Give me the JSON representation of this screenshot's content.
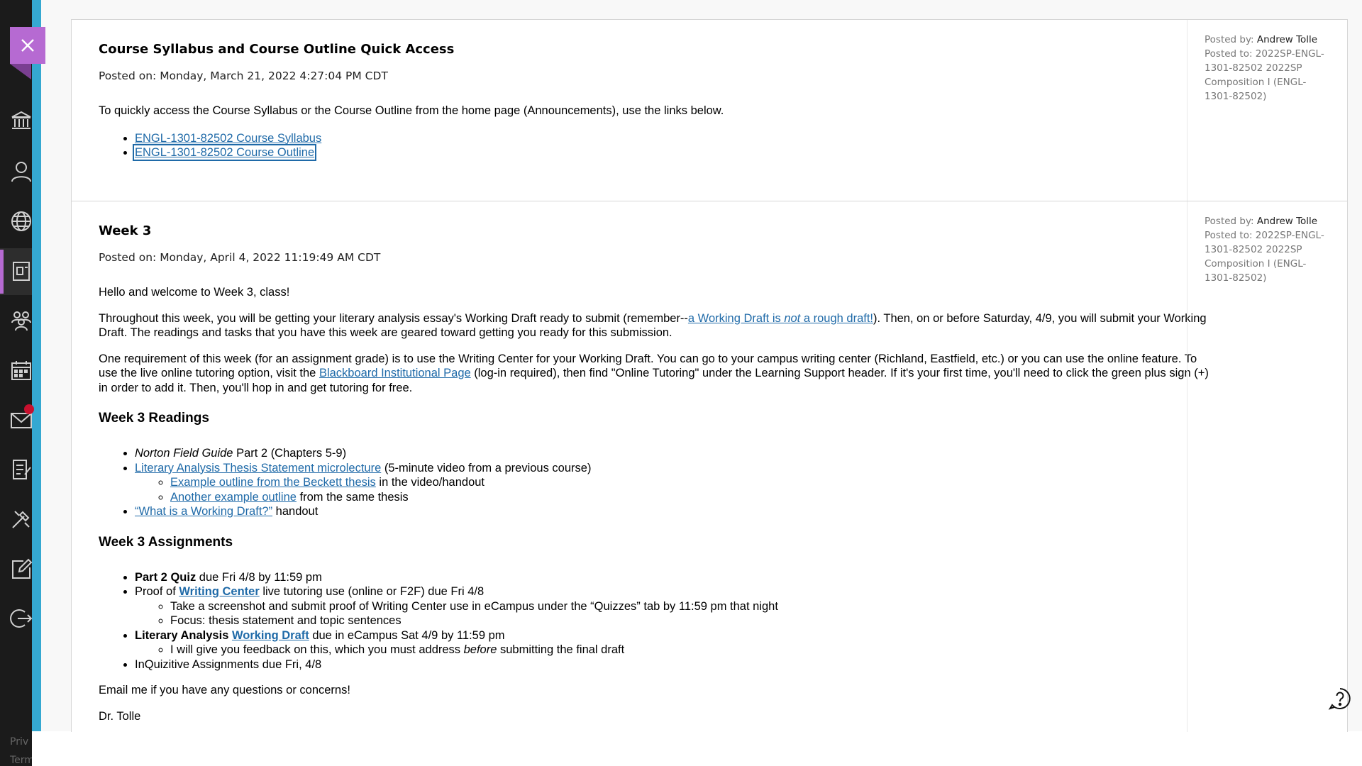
{
  "nav": {
    "close_label": "×",
    "items": [
      {
        "name": "institution-icon"
      },
      {
        "name": "profile-icon"
      },
      {
        "name": "globe-icon"
      },
      {
        "name": "courses-icon"
      },
      {
        "name": "groups-icon"
      },
      {
        "name": "calendar-icon"
      },
      {
        "name": "messages-icon"
      },
      {
        "name": "grades-icon"
      },
      {
        "name": "tools-icon"
      },
      {
        "name": "edit-icon"
      },
      {
        "name": "signout-icon"
      }
    ],
    "privacy": "Priv",
    "terms": "Term"
  },
  "posts": [
    {
      "title": "Course Syllabus and Course Outline Quick Access",
      "posted_on": "Posted on: Monday, March 21, 2022 4:27:04 PM CDT",
      "posted_by_label": "Posted by:",
      "posted_by": "Andrew Tolle",
      "posted_to": "Posted to: 2022SP-ENGL-1301-82502 2022SP Composition I (ENGL-1301-82502)",
      "intro": "To quickly access the Course Syllabus or the Course Outline from the home page (Announcements), use the links below.",
      "links": [
        "ENGL-1301-82502 Course Syllabus",
        "ENGL-1301-82502 Course Outline"
      ]
    },
    {
      "title": "Week 3",
      "posted_on": "Posted on: Monday, April 4, 2022 11:19:49 AM CDT",
      "posted_by_label": "Posted by:",
      "posted_by": "Andrew Tolle",
      "posted_to": "Posted to: 2022SP-ENGL-1301-82502 2022SP Composition I (ENGL-1301-82502)",
      "greeting": "Hello and welcome to Week 3, class!",
      "p1_a": "Throughout this week, you will be getting your literary analysis essay's Working Draft ready to submit (remember--",
      "p1_link_a": "a Working Draft is ",
      "p1_link_em": "not",
      "p1_link_b": " a rough draft!",
      "p1_b": "). Then, on or before Saturday, 4/9, you will submit your Working Draft. The readings and tasks that you have this week are geared toward getting you ready for this submission.",
      "p2_a": "One requirement of this week (for an assignment grade) is to use the Writing Center for your Working Draft. You can go to your campus writing center (Richland, Eastfield, etc.) or you can use the online feature. To use the live online tutoring option, visit the ",
      "p2_link": "Blackboard Institutional Page",
      "p2_b": " (log-in required), then find \"Online Tutoring\" under the Learning Support header. If it's your first time, you'll need to click the green plus sign (+) in order to add it. Then, you'll hop in and get tutoring for free.",
      "readings_heading": "Week 3 Readings",
      "r1_em": "Norton Field Guide",
      "r1_rest": " Part 2 (Chapters 5-9)",
      "r2_link": "Literary Analysis Thesis Statement microlecture",
      "r2_rest": " (5-minute video from a previous course)",
      "r2a_link": "Example outline from the Beckett thesis",
      "r2a_rest": " in the video/handout",
      "r2b_link": "Another example outline",
      "r2b_rest": " from the same thesis",
      "r3_link": "“What is a Working Draft?”",
      "r3_rest": " handout",
      "assignments_heading": "Week 3 Assignments",
      "a1_bold": "Part 2 Quiz",
      "a1_rest": " due Fri 4/8 by 11:59 pm",
      "a2_pre": "Proof of ",
      "a2_link": "Writing Center",
      "a2_rest": " live tutoring use (online or F2F) due Fri 4/8",
      "a2a": "Take a screenshot and submit proof of Writing Center use in eCampus under the “Quizzes” tab by 11:59 pm that night",
      "a2b": "Focus: thesis statement and topic sentences",
      "a3_bold": "Literary Analysis ",
      "a3_link": "Working Draft",
      "a3_rest": " due in eCampus Sat 4/9 by 11:59 pm",
      "a3a_pre": "I will give you feedback on this, which you must address ",
      "a3a_em": "before",
      "a3a_post": " submitting the final draft",
      "a4": "InQuizitive Assignments due Fri, 4/8",
      "closing": "Email me if you have any questions or concerns!",
      "signature": "Dr. Tolle"
    }
  ],
  "help_icon": "help-circle-icon"
}
